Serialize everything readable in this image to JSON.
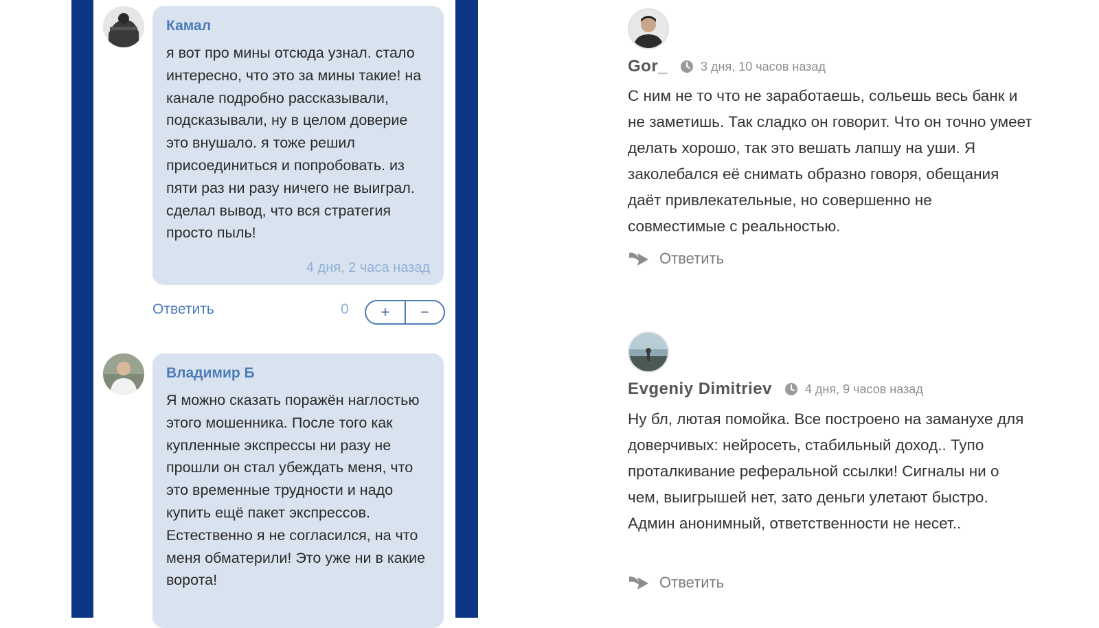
{
  "left_comments": [
    {
      "author": "Камал",
      "text": "я вот про мины отсюда узнал. стало интересно, что это за мины такие! на канале подробно рассказывали, подсказывали, ну в целом доверие это внушало. я тоже решил присоединиться и попробовать. из пяти раз ни разу ничего не выиграл. сделал вывод, что вся стратегия просто пыль!",
      "time": "4 дня, 2 часа назад",
      "reply_label": "Ответить",
      "score": "0",
      "upvote_label": "+",
      "downvote_label": "−",
      "avatar_icon": "user-avatar"
    },
    {
      "author": "Владимир Б",
      "text": "Я можно сказать поражён наглостью этого мошенника. После того как купленные экспрессы ни разу не прошли он стал убеждать меня, что это временные трудности и надо купить ещё пакет экспрессов. Естественно я не согласился, на что меня обматерили! Это уже ни в какие ворота!",
      "avatar_icon": "user-avatar"
    }
  ],
  "right_comments": [
    {
      "author": "Gor_",
      "time": "3 дня, 10 часов назад",
      "text": "С ним не то что не заработаешь, сольешь весь банк и не заметишь. Так сладко он говорит. Что он точно умеет делать хорошо, так это вешать лапшу на уши. Я заколебался её снимать образно говоря, обещания даёт привлекательные, но совершенно не совместимые с реальностью.",
      "reply_label": "Ответить",
      "avatar_icon": "user-avatar"
    },
    {
      "author": "Evgeniy Dimitriev",
      "time": "4 дня, 9 часов назад",
      "text": "Ну бл, лютая помойка. Все построено на заманухе для доверчивых: нейросеть, стабильный доход.. Тупо проталкивание реферальной ссылки! Сигналы ни о чем, выигрышей нет, зато деньги улетают быстро. Админ анонимный, ответственности не несет..",
      "reply_label": "Ответить",
      "avatar_icon": "user-avatar"
    }
  ],
  "colors": {
    "frame": "#0c3585",
    "bubble": "#d9e3ef",
    "author_left": "#4b7bb8",
    "time_left": "#8fb0d8",
    "text": "#2a2a2a"
  },
  "icons": [
    "clock-icon",
    "reply-arrow-icon"
  ]
}
